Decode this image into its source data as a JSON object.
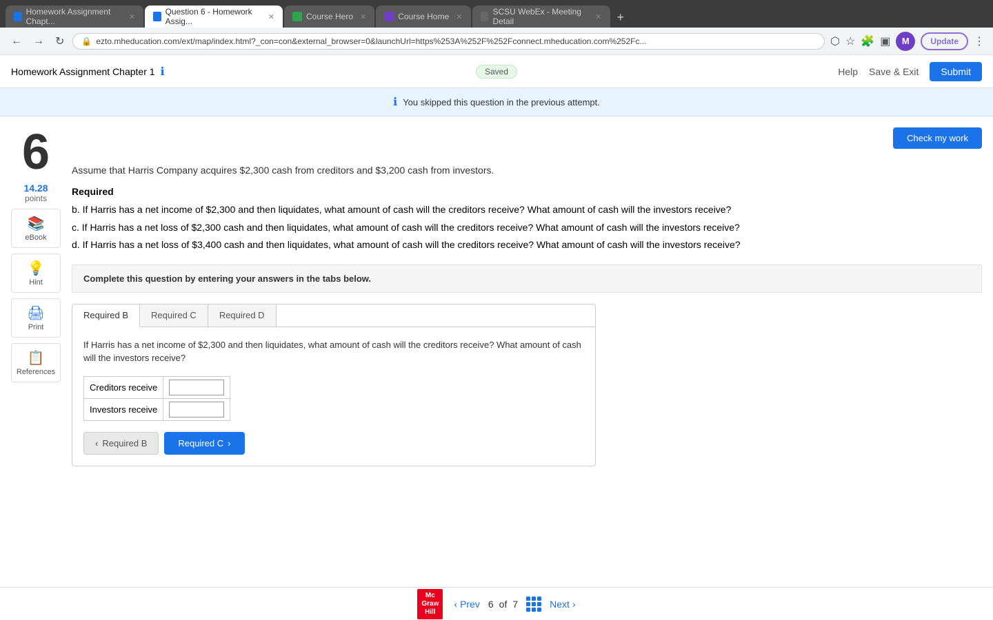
{
  "browser": {
    "tabs": [
      {
        "id": "t1",
        "label": "Homework Assignment Chapt...",
        "active": false,
        "favicon_type": "blue"
      },
      {
        "id": "t2",
        "label": "Question 6 - Homework Assig...",
        "active": true,
        "favicon_type": "blue"
      },
      {
        "id": "t3",
        "label": "Course Hero",
        "active": false,
        "favicon_type": "star"
      },
      {
        "id": "t4",
        "label": "Course Home",
        "active": false,
        "favicon_type": "purple"
      },
      {
        "id": "t5",
        "label": "SCSU WebEx - Meeting Detail",
        "active": false,
        "favicon_type": "webex"
      }
    ],
    "url": "ezto.mheducation.com/ext/map/index.html?_con=con&external_browser=0&launchUrl=https%253A%252F%252Fconnect.mheducation.com%252Fc...",
    "update_btn": "Update",
    "profile_initial": "M"
  },
  "header": {
    "title": "Homework Assignment Chapter 1",
    "saved_label": "Saved",
    "help_label": "Help",
    "save_exit_label": "Save & Exit",
    "submit_label": "Submit"
  },
  "banner": {
    "message": "You skipped this question in the previous attempt."
  },
  "question": {
    "number": "6",
    "points_value": "14.28",
    "points_label": "points",
    "check_work_label": "Check my work",
    "intro": "Assume that Harris Company acquires $2,300 cash from creditors and $3,200 cash from investors.",
    "required_label": "Required",
    "parts": [
      "b. If Harris has a net income of $2,300 and then liquidates, what amount of cash will the creditors receive? What amount of cash will the investors receive?",
      "c. If Harris has a net loss of $2,300 cash and then liquidates, what amount of cash will the creditors receive? What amount of cash will the investors receive?",
      "d. If Harris has a net loss of $3,400 cash and then liquidates, what amount of cash will the creditors receive? What amount of cash will the investors receive?"
    ],
    "complete_instruction": "Complete this question by entering your answers in the tabs below."
  },
  "sidebar_tools": [
    {
      "id": "ebook",
      "label": "eBook",
      "icon": "📚"
    },
    {
      "id": "hint",
      "label": "Hint",
      "icon": "💡"
    },
    {
      "id": "print",
      "label": "Print",
      "icon": "🖨"
    },
    {
      "id": "references",
      "label": "References",
      "icon": "📋"
    }
  ],
  "tabs": {
    "items": [
      {
        "id": "required-b",
        "label": "Required B",
        "active": true
      },
      {
        "id": "required-c",
        "label": "Required C",
        "active": false
      },
      {
        "id": "required-d",
        "label": "Required D",
        "active": false
      }
    ],
    "active_content": {
      "question": "If Harris has a net income of $2,300 and then liquidates, what amount of cash will the creditors receive? What amount of cash will the investors receive?",
      "rows": [
        {
          "label": "Creditors receive",
          "value": ""
        },
        {
          "label": "Investors receive",
          "value": ""
        }
      ]
    }
  },
  "nav_buttons": {
    "prev_label": "Required B",
    "next_label": "Required C"
  },
  "footer": {
    "logo_line1": "Mc",
    "logo_line2": "Graw",
    "logo_line3": "Hill",
    "prev_label": "Prev",
    "next_label": "Next",
    "current_page": "6",
    "total_pages": "7"
  }
}
